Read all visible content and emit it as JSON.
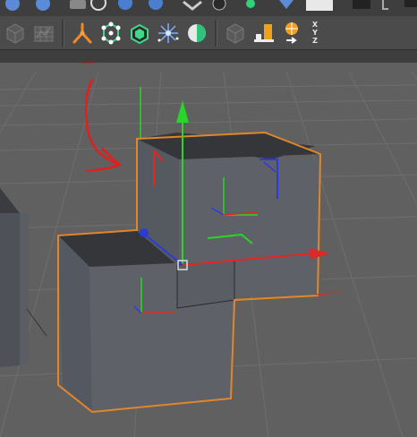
{
  "toolbar": {
    "groups": [
      [
        "cube-icon",
        "grid-icon"
      ],
      [
        "joint-icon",
        "polygon-points-icon",
        "box-mode-icon",
        "sparkle-icon",
        "sphere-half-icon"
      ],
      [
        "cube-outline-icon",
        "bar-chart-icon",
        "globe-xyz-icon"
      ]
    ],
    "xyz_labels": [
      "X",
      "Y",
      "Z"
    ]
  },
  "annotations": {
    "circle_color": "#e01f1f",
    "arrow_color": "#e01f1f"
  },
  "viewport": {
    "axis_colors": {
      "x": "#e02727",
      "y": "#27d627",
      "z": "#2c3bd8"
    },
    "selection_outline": "#e0862b"
  }
}
